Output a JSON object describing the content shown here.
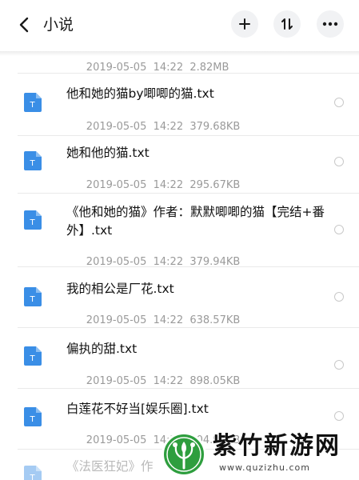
{
  "header": {
    "title": "小说",
    "back_icon": "chevron-left-icon",
    "add_icon": "plus-icon",
    "sort_icon": "sort-icon",
    "more_icon": "more-dots-icon"
  },
  "files": [
    {
      "name": "",
      "date": "2019-05-05",
      "time": "14:22",
      "size": "2.82MB"
    },
    {
      "name": "他和她的猫by唧唧的猫.txt",
      "date": "2019-05-05",
      "time": "14:22",
      "size": "379.68KB"
    },
    {
      "name": "她和他的猫.txt",
      "date": "2019-05-05",
      "time": "14:22",
      "size": "295.67KB"
    },
    {
      "name": "《他和她的猫》作者：默默唧唧的猫【完结+番外】.txt",
      "date": "2019-05-05",
      "time": "14:22",
      "size": "379.94KB"
    },
    {
      "name": "我的相公是厂花.txt",
      "date": "2019-05-05",
      "time": "14:22",
      "size": "638.57KB"
    },
    {
      "name": "偏执的甜.txt",
      "date": "2019-05-05",
      "time": "14:22",
      "size": "898.05KB"
    },
    {
      "name": "白莲花不好当[娱乐圈].txt",
      "date": "2019-05-05",
      "time": "14:22",
      "size": "804.96KB"
    },
    {
      "name": "《法医狂妃》作",
      "date": "",
      "time": "",
      "size": ""
    }
  ],
  "file_icon_letter": "T",
  "watermark": {
    "title": "紫竹新游网",
    "url": "www.quzizhu.com"
  },
  "colors": {
    "file_icon": "#3a8ee6",
    "meta_text": "#9a9a9a",
    "button_bg": "#f1f2f4",
    "watermark_green": "#2e9e3e"
  }
}
